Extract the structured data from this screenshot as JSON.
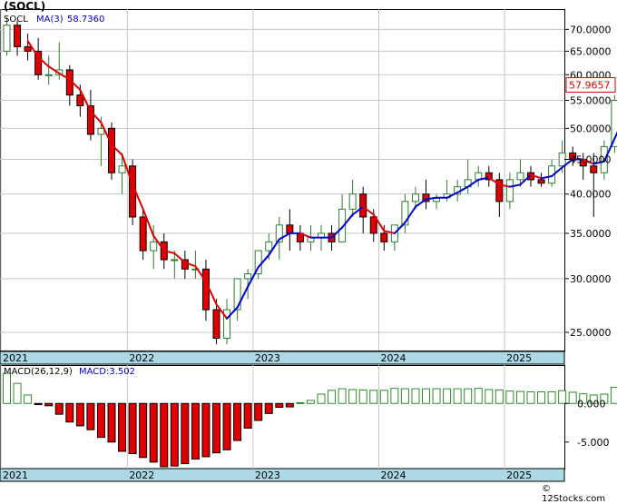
{
  "header": {
    "title": "(SOCL)"
  },
  "legend": {
    "symbol": "SOCL",
    "ma_label": "MA(3)",
    "ma_value": "58.7360",
    "macd_params": "MACD(26,12,9)",
    "macd_value": "MACD:3.502"
  },
  "last_price_label": "57.9657",
  "watermark": "© 12Stocks.com",
  "colors": {
    "up": "#2e7d32",
    "down": "#e00000",
    "ma_down": "#e00000",
    "ma_up": "#0000cc",
    "band": "#add8e6",
    "grid": "#c8c8c8",
    "macd_pos": "#2e8b2e",
    "macd_neg": "#e00000"
  },
  "chart_data": [
    {
      "type": "candlestick",
      "title": "(SOCL)",
      "yscale": "log",
      "ylim": [
        23.5,
        75
      ],
      "yticks": [
        25,
        30,
        35,
        40,
        45,
        50,
        55,
        60,
        65,
        70
      ],
      "ytick_labels": [
        "25.0000",
        "30.0000",
        "35.0000",
        "40.0000",
        "45.0000",
        "50.0000",
        "55.0000",
        "60.0000",
        "65.0000",
        "70.0000"
      ],
      "x_period": "month",
      "xtick_labels": [
        "2021",
        "2022",
        "2023",
        "2024",
        "2025"
      ],
      "candles": [
        [
          "2021-01",
          65,
          73,
          64,
          71
        ],
        [
          "2021-02",
          71,
          72,
          64,
          66
        ],
        [
          "2021-03",
          66,
          69,
          63,
          65
        ],
        [
          "2021-04",
          65,
          68,
          59,
          60
        ],
        [
          "2021-05",
          60,
          64,
          58,
          60
        ],
        [
          "2021-06",
          60,
          67,
          59,
          61
        ],
        [
          "2021-07",
          61,
          62,
          54,
          56
        ],
        [
          "2021-08",
          56,
          58,
          52,
          54
        ],
        [
          "2021-09",
          54,
          57,
          48,
          49
        ],
        [
          "2021-10",
          49,
          52,
          44,
          50
        ],
        [
          "2021-11",
          50,
          51,
          42,
          43
        ],
        [
          "2021-12",
          43,
          46,
          40,
          44
        ],
        [
          "2022-01",
          44,
          45,
          36,
          37
        ],
        [
          "2022-02",
          37,
          38,
          32,
          33
        ],
        [
          "2022-03",
          33,
          36,
          31,
          34
        ],
        [
          "2022-04",
          34,
          35,
          31,
          32
        ],
        [
          "2022-05",
          32,
          33,
          30,
          32
        ],
        [
          "2022-06",
          32,
          33,
          30,
          31
        ],
        [
          "2022-07",
          31,
          33,
          30,
          31
        ],
        [
          "2022-08",
          31,
          32,
          26,
          27
        ],
        [
          "2022-09",
          27,
          28,
          24,
          24.5
        ],
        [
          "2022-10",
          24.5,
          28,
          24,
          27
        ],
        [
          "2022-11",
          27,
          30,
          26,
          30
        ],
        [
          "2022-12",
          30,
          31,
          28,
          30.5
        ],
        [
          "2023-01",
          30.5,
          33,
          30,
          33
        ],
        [
          "2023-02",
          33,
          35,
          32,
          34
        ],
        [
          "2023-03",
          34,
          37,
          32,
          36
        ],
        [
          "2023-04",
          36,
          38,
          33,
          35
        ],
        [
          "2023-05",
          35,
          36,
          33,
          34
        ],
        [
          "2023-06",
          34,
          36,
          33,
          34.5
        ],
        [
          "2023-07",
          34.5,
          36,
          33,
          35
        ],
        [
          "2023-08",
          35,
          36,
          33,
          34
        ],
        [
          "2023-09",
          34,
          40,
          34,
          38
        ],
        [
          "2023-10",
          38,
          42,
          37,
          40
        ],
        [
          "2023-11",
          40,
          41,
          35,
          37
        ],
        [
          "2023-12",
          37,
          38,
          34,
          35
        ],
        [
          "2024-01",
          35,
          36,
          33,
          34
        ],
        [
          "2024-02",
          34,
          36,
          33,
          36
        ],
        [
          "2024-03",
          36,
          40,
          35,
          39
        ],
        [
          "2024-04",
          39,
          41,
          38,
          40
        ],
        [
          "2024-05",
          40,
          42,
          38,
          39
        ],
        [
          "2024-06",
          39,
          40,
          38,
          39.5
        ],
        [
          "2024-07",
          39.5,
          42,
          39,
          40
        ],
        [
          "2024-08",
          40,
          42,
          39,
          41
        ],
        [
          "2024-09",
          41,
          45,
          40,
          42
        ],
        [
          "2024-10",
          42,
          44,
          41,
          43
        ],
        [
          "2024-11",
          43,
          44,
          41,
          42
        ],
        [
          "2024-12",
          42,
          43,
          37,
          39
        ],
        [
          "2025-01",
          39,
          43,
          38,
          42
        ],
        [
          "2025-02",
          42,
          45,
          41,
          43
        ],
        [
          "2025-03",
          43,
          44,
          41,
          42
        ],
        [
          "2025-04",
          42,
          43,
          41,
          41.5
        ],
        [
          "2025-05",
          41.5,
          45,
          41,
          44
        ],
        [
          "2025-06",
          44,
          48,
          43,
          46
        ],
        [
          "2025-07",
          46,
          47,
          44,
          45
        ],
        [
          "2025-08",
          45,
          46,
          42,
          44
        ],
        [
          "2025-09",
          44,
          46,
          37,
          43
        ],
        [
          "2025-10",
          43,
          48,
          42,
          47
        ],
        [
          "2025-11",
          47,
          56,
          46,
          55
        ],
        [
          "2025-12",
          55,
          61,
          54,
          57
        ],
        [
          "2026-01",
          57,
          62,
          55,
          59
        ],
        [
          "2026-02",
          59,
          64,
          57,
          60
        ],
        [
          "2026-03",
          60,
          61,
          57,
          57.97
        ]
      ],
      "ma3": [
        null,
        null,
        67.3,
        63.7,
        61.7,
        60.3,
        59.0,
        57.0,
        53.0,
        51.0,
        47.3,
        45.7,
        41.3,
        38.0,
        34.7,
        33.0,
        32.7,
        31.7,
        31.3,
        29.7,
        27.5,
        26.2,
        27.2,
        29.2,
        31.2,
        32.5,
        34.3,
        35.0,
        35.0,
        34.5,
        34.5,
        34.5,
        35.7,
        37.3,
        38.3,
        37.3,
        35.3,
        35.0,
        36.3,
        38.3,
        39.3,
        39.5,
        39.5,
        40.2,
        41.0,
        42.0,
        42.3,
        41.3,
        41.0,
        41.3,
        42.7,
        42.2,
        42.5,
        43.8,
        45.0,
        45.0,
        44.3,
        44.7,
        48.3,
        52.3,
        57.0,
        58.7
      ]
    },
    {
      "type": "bar",
      "title": "MACD(26,12,9)",
      "ylim": [
        -8200,
        4500
      ],
      "yticks": [
        0,
        -5000
      ],
      "ytick_labels": [
        "0.000",
        "-5.000"
      ],
      "xtick_labels": [
        "2021",
        "2022",
        "2023",
        "2024",
        "2025"
      ],
      "values": [
        3900,
        2600,
        1100,
        -150,
        -300,
        -1400,
        -2400,
        -2900,
        -3400,
        -4400,
        -5000,
        -6200,
        -6500,
        -7000,
        -7600,
        -8200,
        -8100,
        -7800,
        -7200,
        -6900,
        -6400,
        -6000,
        -4800,
        -3200,
        -2200,
        -1300,
        -500,
        -450,
        100,
        400,
        1200,
        1700,
        1900,
        1800,
        1750,
        1700,
        1700,
        1950,
        1900,
        1900,
        1900,
        1900,
        1900,
        1900,
        1900,
        1950,
        1800,
        1750,
        1600,
        1550,
        1500,
        1500,
        1500,
        1650,
        1450,
        1250,
        1100,
        1200,
        2100,
        2800,
        3500,
        3500
      ]
    }
  ]
}
